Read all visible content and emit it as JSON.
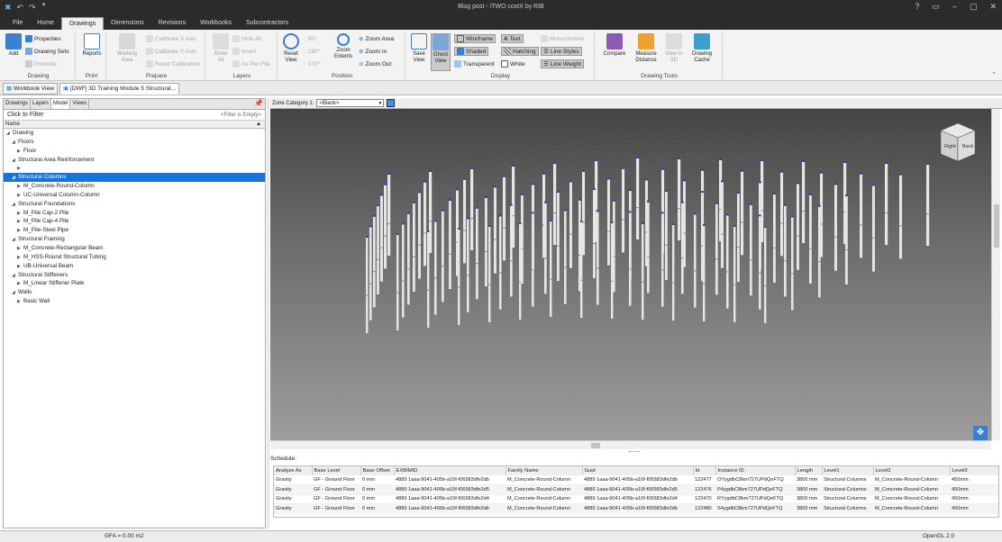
{
  "window": {
    "title": "Blog post - iTWO costX by RIB"
  },
  "menu": [
    "File",
    "Home",
    "Drawings",
    "Dimensions",
    "Revisions",
    "Workbooks",
    "Subcontractors"
  ],
  "menu_active": 2,
  "ribbon": {
    "drawing": {
      "label": "Drawing",
      "add": "Add",
      "properties": "Properties",
      "drawing_sets": "Drawing Sets",
      "promote": "Promote"
    },
    "print": {
      "label": "Print",
      "reports": "Reports"
    },
    "prepare": {
      "label": "Prepare",
      "working_area": "Working Area",
      "calibrate_x": "Calibrate X Axis",
      "calibrate_y": "Calibrate Y Axis",
      "reset_calibration": "Reset Calibration"
    },
    "layers": {
      "label": "Layers",
      "show_all": "Show All",
      "hide_all": "Hide All",
      "invert": "Invert",
      "as_per_file": "As Per File"
    },
    "position": {
      "label": "Position",
      "reset_view": "Reset View",
      "deg90": "90°",
      "deg180": "180°",
      "deg270": "270°",
      "zoom_extents": "Zoom Extents",
      "zoom_area": "Zoom Area",
      "zoom_in": "Zoom In",
      "zoom_out": "Zoom Out"
    },
    "display": {
      "label": "Display",
      "save_view": "Save View",
      "ghost_view": "Ghost View",
      "wireframe": "Wireframe",
      "shaded": "Shaded",
      "transparent": "Transparent",
      "text": "Text",
      "hatching": "Hatching",
      "white": "White",
      "monochrome": "Monochrome",
      "line_styles": "Line Styles",
      "line_weight": "Line Weight"
    },
    "tools": {
      "label": "Drawing Tools",
      "compare": "Compare",
      "measure_distance": "Measure Distance",
      "view_in_3d": "View in 3D",
      "drawing_cache": "Drawing Cache"
    }
  },
  "doc_tabs": [
    "Workbook View",
    "[DWF] 3D Training Module 5 Structural..."
  ],
  "left_panel": {
    "tabs": [
      "Drawings",
      "Layers",
      "Model",
      "Views"
    ],
    "active_tab": 2,
    "filter_label": "Click to Filter",
    "filter_empty": "<Filter is Empty>",
    "column_header": "Name",
    "tree": [
      {
        "level": 0,
        "toggle": "◢",
        "label": "Drawing"
      },
      {
        "level": 1,
        "toggle": "◢",
        "label": "Floors"
      },
      {
        "level": 2,
        "toggle": "▶",
        "label": "Floor"
      },
      {
        "level": 1,
        "toggle": "◢",
        "label": "Structural Area Reinforcement"
      },
      {
        "level": 2,
        "toggle": "▶",
        "label": ""
      },
      {
        "level": 1,
        "toggle": "◢",
        "label": "Structural Columns",
        "selected": true
      },
      {
        "level": 2,
        "toggle": "▶",
        "label": "M_Concrete-Round-Column"
      },
      {
        "level": 2,
        "toggle": "▶",
        "label": "UC-Universal Column-Column"
      },
      {
        "level": 1,
        "toggle": "◢",
        "label": "Structural Foundations"
      },
      {
        "level": 2,
        "toggle": "▶",
        "label": "M_Pile Cap-2 Pile"
      },
      {
        "level": 2,
        "toggle": "▶",
        "label": "M_Pile Cap-4 Pile"
      },
      {
        "level": 2,
        "toggle": "▶",
        "label": "M_Pile-Steel Pipe"
      },
      {
        "level": 1,
        "toggle": "◢",
        "label": "Structural Framing"
      },
      {
        "level": 2,
        "toggle": "▶",
        "label": "M_Concrete-Rectangular Beam"
      },
      {
        "level": 2,
        "toggle": "▶",
        "label": "M_HSS-Round Structural Tubing"
      },
      {
        "level": 2,
        "toggle": "▶",
        "label": "UB-Universal Beam"
      },
      {
        "level": 1,
        "toggle": "◢",
        "label": "Structural Stiffeners"
      },
      {
        "level": 2,
        "toggle": "▶",
        "label": "M_Linear Stiffener Plate"
      },
      {
        "level": 1,
        "toggle": "◢",
        "label": "Walls"
      },
      {
        "level": 2,
        "toggle": "▶",
        "label": "Basic Wall"
      }
    ]
  },
  "viewport": {
    "zone_label": "Zone Category 1:",
    "zone_value": "<Blank>",
    "cube_right": "Right",
    "cube_back": "Back"
  },
  "schedule": {
    "title": "Schedule:",
    "columns": [
      "Analyze As",
      "Base Level",
      "Base Offset",
      "EXBIMID",
      "Family Name",
      "Guid",
      "Id",
      "Instance ID",
      "Length",
      "Level1",
      "Level2",
      "Level3"
    ],
    "rows": [
      [
        "Gravity",
        "GF - Ground Floor",
        "0 mm",
        "4889 1aaa-9041-405b-a10f-f06583dfe2db",
        "M_Concrete-Round-Column",
        "4889 1aaa-9041-405b-a10f-f06583dfe2db",
        "122477",
        "OYygdbC8km727UPdQeFTQ",
        "3800 mm",
        "Structural Columns",
        "M_Concrete-Round-Column",
        "450mm"
      ],
      [
        "Gravity",
        "GF - Ground Floor",
        "0 mm",
        "4889 1aaa-9041-405b-a10f-f06583dfe2d5",
        "M_Concrete-Round-Column",
        "4889 1aaa-9041-405b-a10f-f06583dfe2d5",
        "122476",
        "P4ygdbC8km727UPdQeFTQ",
        "3800 mm",
        "Structural Columns",
        "M_Concrete-Round-Column",
        "450mm"
      ],
      [
        "Gravity",
        "GF - Ground Floor",
        "0 mm",
        "4889 1aaa-9041-405b-a10f-f06583dfe2d4",
        "M_Concrete-Round-Column",
        "4889 1aaa-9041-405b-a10f-f06583dfe2d4",
        "122470",
        "RYygdbC8km727UPdQeFTQ",
        "3800 mm",
        "Structural Columns",
        "M_Concrete-Round-Column",
        "450mm"
      ],
      [
        "Gravity",
        "GF - Ground Floor",
        "0 mm",
        "4889 1aaa-9041-405b-a10f-f06583dfe2db",
        "M_Concrete-Round-Column",
        "4889 1aaa-9041-405b-a10f-f06583dfe2db",
        "122480",
        "S4ygdbC8km727UPdQeFTQ",
        "3800 mm",
        "Structural Columns",
        "M_Concrete-Round-Column",
        "450mm"
      ]
    ]
  },
  "status": {
    "gfa": "GFA = 0.00 m2",
    "renderer": "OpenGL 2.0"
  },
  "colors": {
    "accent": "#1a73d9",
    "titlebar": "#2b2b2b",
    "ribbon": "#f3f3f3",
    "column": "#e6e6e6",
    "column_top": "#3a3aa8"
  }
}
